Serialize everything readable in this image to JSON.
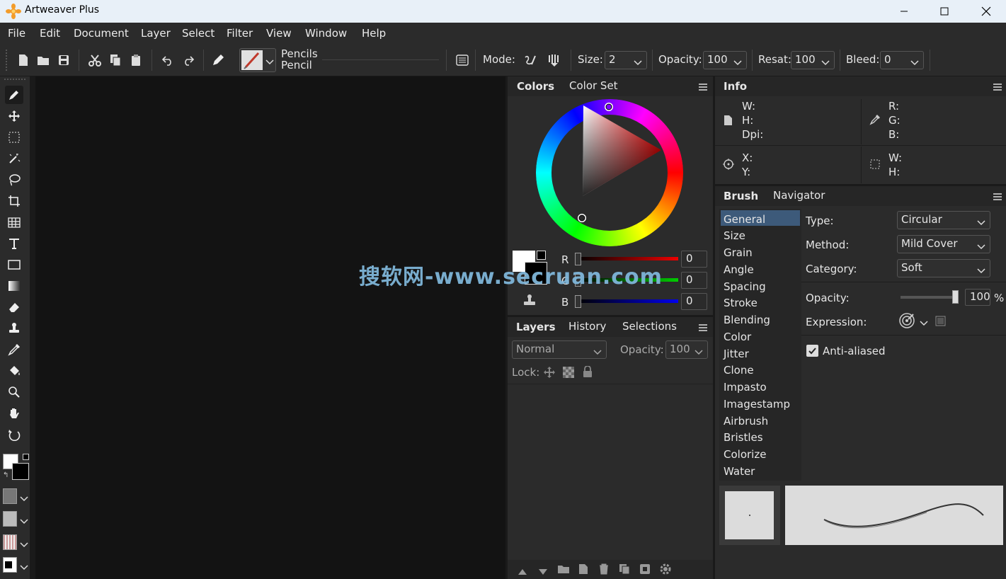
{
  "app": {
    "title": "Artweaver Plus"
  },
  "menu": [
    "File",
    "Edit",
    "Document",
    "Layer",
    "Select",
    "Filter",
    "View",
    "Window",
    "Help"
  ],
  "toolbar": {
    "brush_category": "Pencils",
    "brush_name": "Pencil",
    "mode_label": "Mode:",
    "size_label": "Size:",
    "size_value": "2",
    "opacity_label": "Opacity:",
    "opacity_value": "100",
    "resat_label": "Resat:",
    "resat_value": "100",
    "bleed_label": "Bleed:",
    "bleed_value": "0"
  },
  "colors_panel": {
    "tabs": [
      "Colors",
      "Color Set"
    ],
    "r_label": "R",
    "g_label": "G",
    "b_label": "B",
    "r_value": "0",
    "g_value": "0",
    "b_value": "0"
  },
  "info_panel": {
    "tab": "Info",
    "w": "W:",
    "h": "H:",
    "dpi": "Dpi:",
    "r": "R:",
    "g": "G:",
    "b": "B:",
    "x": "X:",
    "y": "Y:",
    "sw": "W:",
    "sh": "H:"
  },
  "layers_panel": {
    "tabs": [
      "Layers",
      "History",
      "Selections"
    ],
    "blend_mode": "Normal",
    "opacity_label": "Opacity:",
    "opacity_value": "100",
    "lock_label": "Lock:"
  },
  "brush_panel": {
    "tabs": [
      "Brush",
      "Navigator"
    ],
    "categories": [
      "General",
      "Size",
      "Grain",
      "Angle",
      "Spacing",
      "Stroke",
      "Blending",
      "Color",
      "Jitter",
      "Clone",
      "Impasto",
      "Imagestamp",
      "Airbrush",
      "Bristles",
      "Colorize",
      "Water"
    ],
    "selected_category": "General",
    "type_label": "Type:",
    "type_value": "Circular",
    "method_label": "Method:",
    "method_value": "Mild Cover",
    "category_label": "Category:",
    "category_value": "Soft",
    "opacity_label": "Opacity:",
    "opacity_value": "100",
    "opacity_unit": "%",
    "expression_label": "Expression:",
    "antialiased_label": "Anti-aliased",
    "antialiased": true
  },
  "watermark": "搜软网-www.secruan.com",
  "colors": {
    "accent_selected": "#3d5a7a",
    "fg": "#000000",
    "bg": "#ffffff"
  }
}
